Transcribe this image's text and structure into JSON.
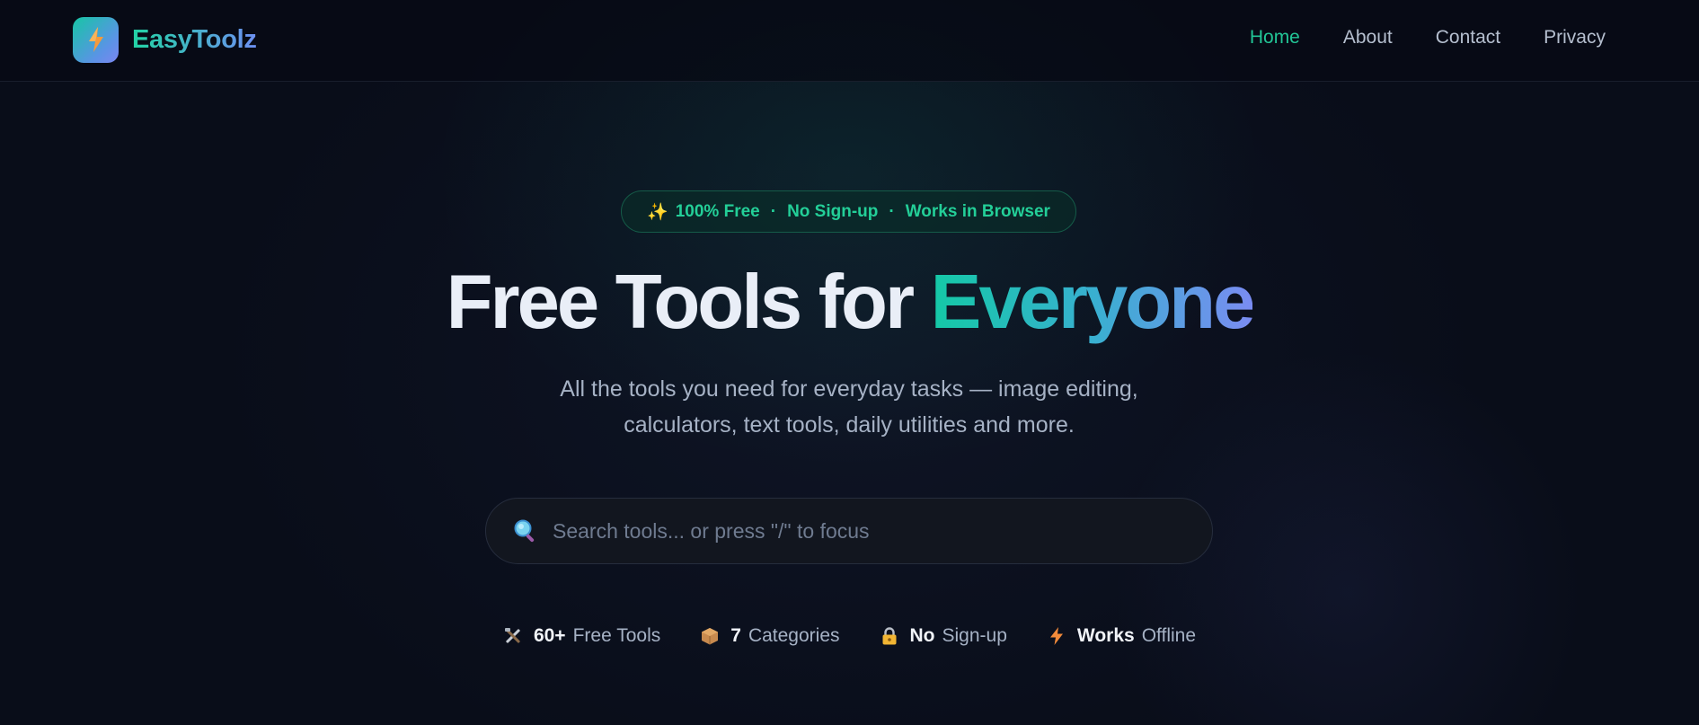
{
  "brand": {
    "name": "EasyToolz",
    "logo_icon": "lightning-bolt-icon",
    "accent_from": "#16c6a5",
    "accent_to": "#7c86f0"
  },
  "nav": {
    "items": [
      {
        "label": "Home",
        "active": true
      },
      {
        "label": "About",
        "active": false
      },
      {
        "label": "Contact",
        "active": false
      },
      {
        "label": "Privacy",
        "active": false
      }
    ],
    "active_color": "#22c596"
  },
  "hero": {
    "badge": {
      "icon": "sparkles-icon",
      "parts": [
        "100% Free",
        "No Sign-up",
        "Works in Browser"
      ],
      "separator": "·"
    },
    "headline_prefix": "Free Tools for ",
    "headline_accent": "Everyone",
    "subtitle": "All the tools you need for everyday tasks — image editing, calculators, text tools, daily utilities and more.",
    "search": {
      "icon": "magnifier-icon",
      "placeholder": "Search tools... or press \"/\" to focus",
      "value": ""
    },
    "stats": [
      {
        "icon": "tools-icon",
        "value": "60+",
        "label": "Free Tools"
      },
      {
        "icon": "package-icon",
        "value": "7",
        "label": "Categories"
      },
      {
        "icon": "lock-icon",
        "value": "No",
        "label": "Sign-up"
      },
      {
        "icon": "lightning-icon",
        "value": "Works",
        "label": "Offline"
      }
    ]
  }
}
